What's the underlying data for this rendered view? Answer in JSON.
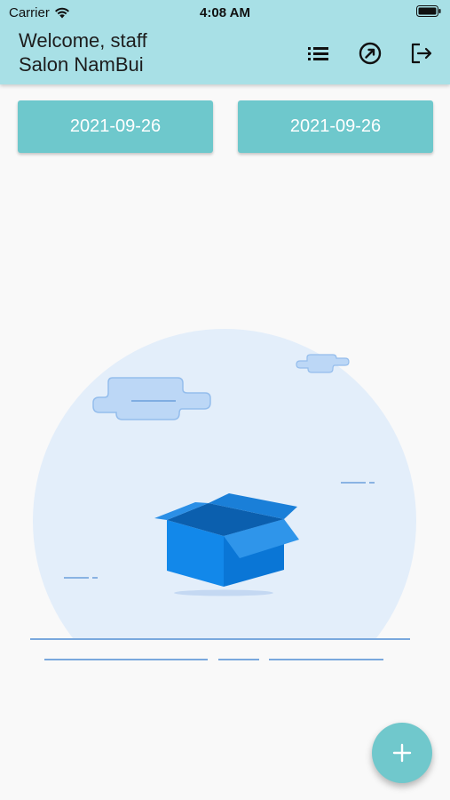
{
  "status_bar": {
    "carrier": "Carrier",
    "time": "4:08 AM"
  },
  "header": {
    "line1": "Welcome, staff",
    "line2": "Salon NamBui",
    "background": "#a8e0e6"
  },
  "actions": [
    {
      "icon": "list-icon"
    },
    {
      "icon": "navigation-compass-icon"
    },
    {
      "icon": "logout-icon"
    }
  ],
  "date_filter": {
    "start_date": "2021-09-26",
    "end_date": "2021-09-26",
    "button_color": "#6ec8cc"
  },
  "empty_state": {
    "illustration": "empty-box-illustration"
  },
  "fab": {
    "icon": "plus-icon",
    "color": "#70c8cc"
  }
}
